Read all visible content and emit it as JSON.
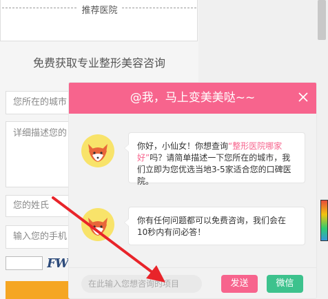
{
  "page": {
    "recommended_title": "推荐医院",
    "consult_title": "免费获取专业整形美容咨询",
    "form": {
      "city_placeholder": "您所在的城市",
      "desc_placeholder": "详细描述您的",
      "name_placeholder": "您的姓氏",
      "phone_placeholder": "输入您的手机",
      "captcha_text": "FW"
    }
  },
  "chat": {
    "title": "@我，马上变美美哒~~",
    "messages": [
      {
        "text_before": "你好，小仙女！你想查询",
        "highlight": "“整形医院哪家好”",
        "text_after": "吗？请简单描述一下您所在的城市，我们立即为您优选当地3-5家适合您的口碑医院。"
      },
      {
        "text_before": "你有任何问题都可以免费咨询，我们会在10秒内有问必答！",
        "highlight": "",
        "text_after": ""
      }
    ],
    "input_placeholder": "在此输入您想咨询的项目",
    "send_label": "发送",
    "wechat_label": "微信"
  },
  "colors": {
    "accent_pink": "#f7648d",
    "wechat_green": "#3dc28d",
    "avatar_yellow": "#f8e36a",
    "arrow_red": "#e8242a"
  },
  "icons": {
    "close": "close-icon",
    "avatar": "fox-avatar-icon"
  }
}
